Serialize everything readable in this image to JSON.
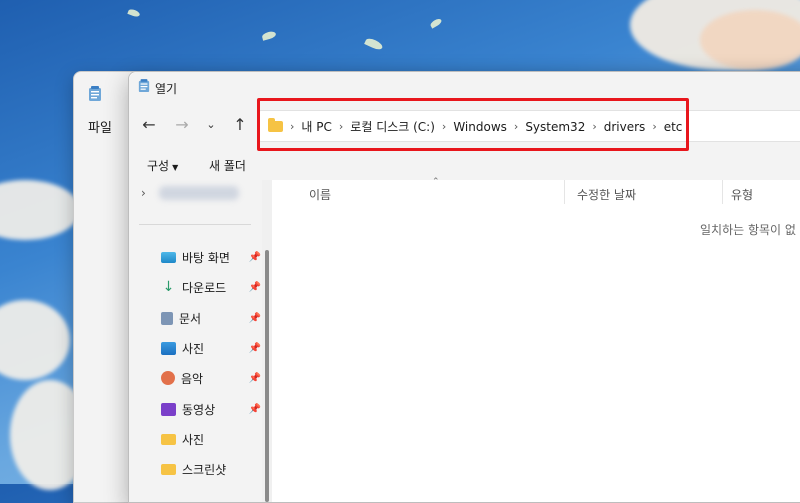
{
  "back_window": {
    "menu_file": "파일"
  },
  "dialog": {
    "title": "열기",
    "address": {
      "crumbs": [
        "내 PC",
        "로컬 디스크 (C:)",
        "Windows",
        "System32",
        "drivers",
        "etc"
      ]
    },
    "toolbar": {
      "organize": "구성",
      "new_folder": "새 폴더"
    },
    "nav_items": [
      {
        "label": "바탕 화면",
        "icon": "desktop-icon",
        "pinned": true
      },
      {
        "label": "다운로드",
        "icon": "download-icon",
        "pinned": true
      },
      {
        "label": "문서",
        "icon": "document-icon",
        "pinned": true
      },
      {
        "label": "사진",
        "icon": "pictures-icon",
        "pinned": true
      },
      {
        "label": "음악",
        "icon": "music-icon",
        "pinned": true
      },
      {
        "label": "동영상",
        "icon": "video-icon",
        "pinned": true
      },
      {
        "label": "사진",
        "icon": "folder-icon",
        "pinned": false
      },
      {
        "label": "스크린샷",
        "icon": "folder-icon",
        "pinned": false
      }
    ],
    "columns": {
      "name": "이름",
      "modified": "수정한 날짜",
      "type": "유형"
    },
    "empty_message": "일치하는 항목이 없"
  },
  "colors": {
    "highlight": "#e8161c",
    "folder": "#f6c344"
  }
}
